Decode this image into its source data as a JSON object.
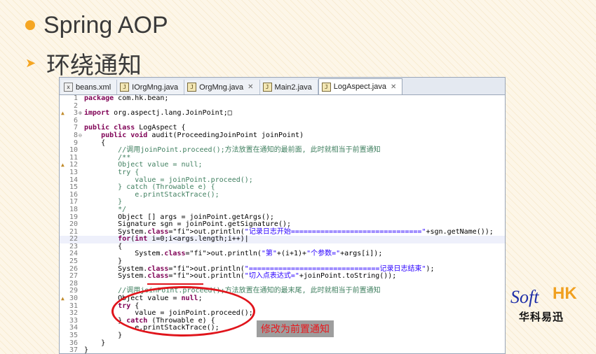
{
  "slide": {
    "title": "Spring AOP",
    "subtitle": "环绕通知"
  },
  "colors": {
    "accent": "#f5a623",
    "annotation": "#e0141b",
    "logo_blue": "#1f2fa8",
    "logo_orange": "#f0a020"
  },
  "editor": {
    "tabs": [
      {
        "label": "beans.xml",
        "icon": "xml-file-icon",
        "active": false
      },
      {
        "label": "IOrgMng.java",
        "icon": "java-file-icon",
        "active": false
      },
      {
        "label": "OrgMng.java",
        "icon": "java-file-icon",
        "active": true
      },
      {
        "label": "Main2.java",
        "icon": "java-file-icon",
        "active": false
      },
      {
        "label": "LogAspect.java",
        "icon": "java-file-icon",
        "active": true
      }
    ],
    "lines": [
      {
        "n": "1",
        "t": "package com.hk.bean;"
      },
      {
        "n": "2",
        "t": ""
      },
      {
        "n": "3",
        "t": "import org.aspectj.lang.JoinPoint;□",
        "mark": "warn",
        "fold": "⊕"
      },
      {
        "n": "6",
        "t": ""
      },
      {
        "n": "7",
        "t": "public class LogAspect {"
      },
      {
        "n": "8",
        "t": "    public void audit(ProceedingJoinPoint joinPoint)",
        "fold": "⊖"
      },
      {
        "n": "9",
        "t": "    {"
      },
      {
        "n": "10",
        "t": "        //调用joinPoint.proceed();方法放置在通知的最前面, 此时就相当于前置通知",
        "c": "cm"
      },
      {
        "n": "11",
        "t": "        /**",
        "c": "cm"
      },
      {
        "n": "12",
        "t": "        Object value = null;",
        "c": "cm",
        "mark": "warn"
      },
      {
        "n": "13",
        "t": "        try {",
        "c": "cm"
      },
      {
        "n": "14",
        "t": "            value = joinPoint.proceed();",
        "c": "cm"
      },
      {
        "n": "15",
        "t": "        } catch (Throwable e) {",
        "c": "cm"
      },
      {
        "n": "16",
        "t": "            e.printStackTrace();",
        "c": "cm"
      },
      {
        "n": "17",
        "t": "        }",
        "c": "cm"
      },
      {
        "n": "18",
        "t": "        */",
        "c": "cm"
      },
      {
        "n": "19",
        "t": "        Object [] args = joinPoint.getArgs();"
      },
      {
        "n": "20",
        "t": "        Signature sgn = joinPoint.getSignature();"
      },
      {
        "n": "21",
        "t": "        System.out.println(\"记录日志开始===============================\"+sgn.getName());"
      },
      {
        "n": "22",
        "t": "        for(int i=0;i<args.length;i++)|",
        "hl": true
      },
      {
        "n": "23",
        "t": "        {"
      },
      {
        "n": "24",
        "t": "            System.out.println(\"第\"+(i+1)+\"个参数=\"+args[i]);"
      },
      {
        "n": "25",
        "t": "        }"
      },
      {
        "n": "26",
        "t": "        System.out.println(\"===============================记录日志结束\");"
      },
      {
        "n": "27",
        "t": "        System.out.println(\"切入点表达式=\"+joinPoint.toString());"
      },
      {
        "n": "28",
        "t": ""
      },
      {
        "n": "29",
        "t": "        //调用joinPoint.proceed();方法放置在通知的最末尾, 此时就相当于前置通知",
        "c": "cm"
      },
      {
        "n": "30",
        "t": "        Object value = null;",
        "mark": "warn"
      },
      {
        "n": "31",
        "t": "        try {"
      },
      {
        "n": "32",
        "t": "            value = joinPoint.proceed();"
      },
      {
        "n": "33",
        "t": "        } catch (Throwable e) {"
      },
      {
        "n": "34",
        "t": "            e.printStackTrace();"
      },
      {
        "n": "35",
        "t": "        }"
      },
      {
        "n": "36",
        "t": "    }"
      },
      {
        "n": "37",
        "t": "}"
      }
    ]
  },
  "annotation": {
    "callout": "修改为前置通知"
  },
  "logo": {
    "soft": "Soft",
    "hk": "HK",
    "cn": "华科易迅"
  }
}
